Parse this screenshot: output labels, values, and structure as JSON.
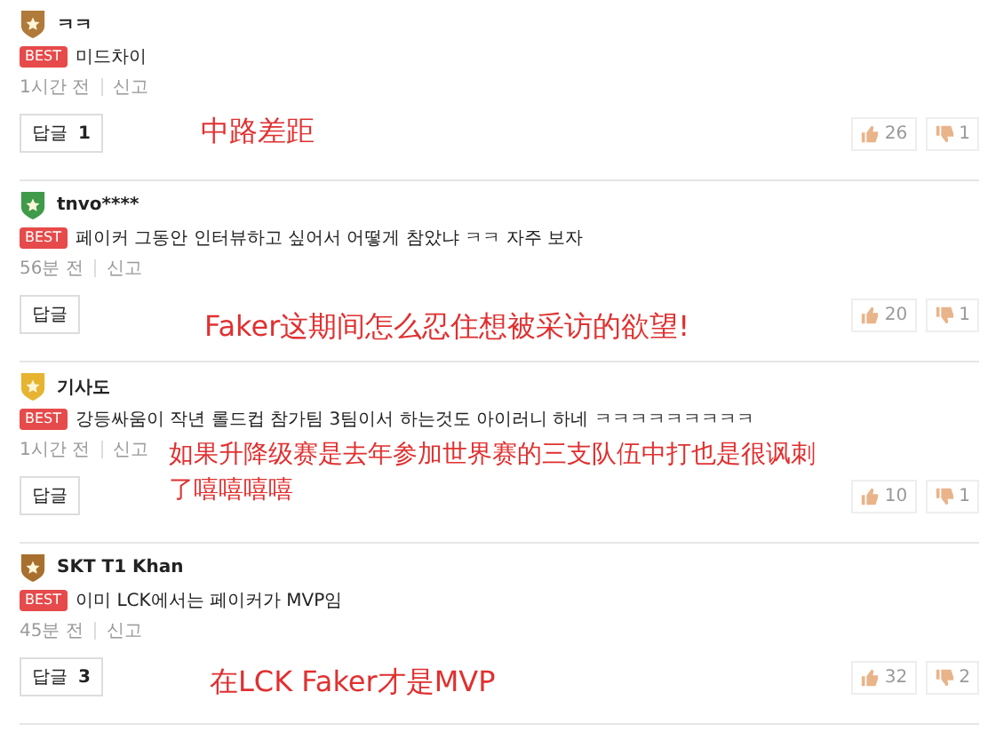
{
  "comments": [
    {
      "author": "ㅋㅋ",
      "color": "#b07a3a",
      "best_label": "BEST",
      "text": "미드차이",
      "time": "1시간 전",
      "report": "신고",
      "reply_label": "답글",
      "reply_count": "1",
      "likes": "26",
      "dislikes": "1",
      "annotation": "中路差距"
    },
    {
      "author": "tnvo****",
      "color": "#3f9a4a",
      "best_label": "BEST",
      "text": "페이커 그동안 인터뷰하고 싶어서 어떻게 참았냐 ㅋㅋ 자주 보자",
      "time": "56분 전",
      "report": "신고",
      "reply_label": "답글",
      "likes": "20",
      "dislikes": "1",
      "annotation": "Faker这期间怎么忍住想被采访的欲望!"
    },
    {
      "author": "기사도",
      "color": "#e6b431",
      "best_label": "BEST",
      "text": "강등싸움이 작년 롤드컵 참가팀 3팀이서 하는것도 아이러니 하네 ㅋㅋㅋㅋㅋㅋㅋㅋㅋ",
      "time": "1시간 전",
      "report": "신고",
      "reply_label": "답글",
      "likes": "10",
      "dislikes": "1",
      "annotation": "如果升降级赛是去年参加世界赛的三支队伍中打也是很讽刺了嘻嘻嘻嘻"
    },
    {
      "author": "SKT T1 Khan",
      "color": "#a8702e",
      "best_label": "BEST",
      "text": "이미 LCK에서는 페이커가 MVP임",
      "time": "45분 전",
      "report": "신고",
      "reply_label": "답글",
      "reply_count": "3",
      "likes": "32",
      "dislikes": "2",
      "annotation": "在LCK Faker才是MVP"
    }
  ]
}
